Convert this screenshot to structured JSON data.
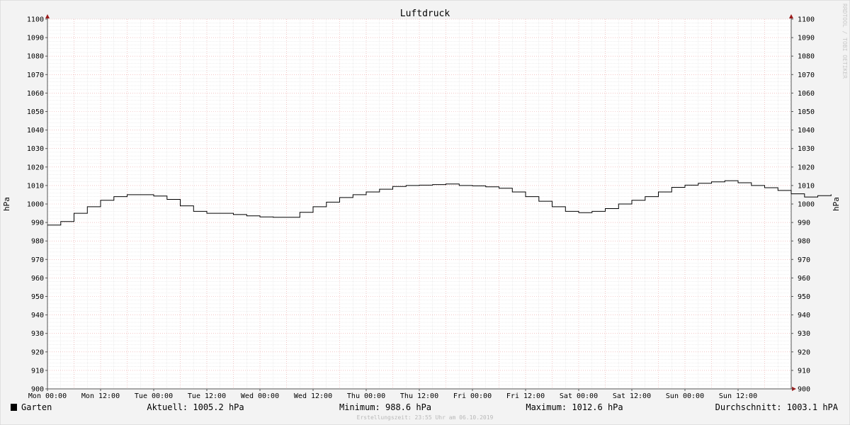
{
  "chart_data": {
    "type": "line",
    "title": "Luftdruck",
    "ylabel": "hPa",
    "ylim": [
      900,
      1100
    ],
    "ytick_step": 10,
    "grid": true,
    "x_tick_labels": [
      "Mon 00:00",
      "Mon 12:00",
      "Tue 00:00",
      "Tue 12:00",
      "Wed 00:00",
      "Wed 12:00",
      "Thu 00:00",
      "Thu 12:00",
      "Fri 00:00",
      "Fri 12:00",
      "Sat 00:00",
      "Sat 12:00",
      "Sun 00:00",
      "Sun 12:00"
    ],
    "x_hours_range": [
      0,
      168
    ],
    "series": [
      {
        "name": "Garten",
        "color": "#000000",
        "points": [
          [
            0,
            988.6
          ],
          [
            3,
            990.5
          ],
          [
            6,
            995.0
          ],
          [
            9,
            998.5
          ],
          [
            12,
            1002.0
          ],
          [
            15,
            1004.0
          ],
          [
            18,
            1005.0
          ],
          [
            21,
            1005.0
          ],
          [
            24,
            1004.3
          ],
          [
            27,
            1002.5
          ],
          [
            30,
            999.0
          ],
          [
            33,
            996.0
          ],
          [
            36,
            995.0
          ],
          [
            39,
            995.0
          ],
          [
            42,
            994.3
          ],
          [
            45,
            993.6
          ],
          [
            48,
            993.0
          ],
          [
            51,
            992.8
          ],
          [
            54,
            992.8
          ],
          [
            57,
            995.5
          ],
          [
            60,
            998.5
          ],
          [
            63,
            1001.0
          ],
          [
            66,
            1003.5
          ],
          [
            69,
            1005.0
          ],
          [
            72,
            1006.5
          ],
          [
            75,
            1008.0
          ],
          [
            78,
            1009.5
          ],
          [
            81,
            1010.0
          ],
          [
            84,
            1010.2
          ],
          [
            87,
            1010.5
          ],
          [
            90,
            1010.8
          ],
          [
            93,
            1010.0
          ],
          [
            96,
            1009.8
          ],
          [
            99,
            1009.3
          ],
          [
            102,
            1008.5
          ],
          [
            105,
            1006.5
          ],
          [
            108,
            1004.0
          ],
          [
            111,
            1001.5
          ],
          [
            114,
            998.5
          ],
          [
            117,
            996.0
          ],
          [
            120,
            995.3
          ],
          [
            123,
            996.0
          ],
          [
            126,
            997.5
          ],
          [
            129,
            1000.0
          ],
          [
            132,
            1002.0
          ],
          [
            135,
            1004.0
          ],
          [
            138,
            1006.5
          ],
          [
            141,
            1009.0
          ],
          [
            144,
            1010.2
          ],
          [
            147,
            1011.2
          ],
          [
            150,
            1012.0
          ],
          [
            153,
            1012.6
          ],
          [
            156,
            1011.5
          ],
          [
            159,
            1010.0
          ],
          [
            162,
            1008.8
          ],
          [
            165,
            1007.3
          ],
          [
            168,
            1005.5
          ],
          [
            171,
            1003.8
          ],
          [
            174,
            1004.5
          ],
          [
            177,
            1005.2
          ]
        ]
      }
    ]
  },
  "legend": {
    "series_name": "Garten",
    "current": "Aktuell: 1005.2 hPa",
    "minimum": "Minimum: 988.6 hPa",
    "maximum": "Maximum: 1012.6 hPa",
    "average": "Durchschnitt: 1003.1 hPA"
  },
  "side_text": "RRDTOOL / TOBI OETIKER",
  "footer": "Erstellungszeit: 23:55 Uhr am 06.10.2019"
}
